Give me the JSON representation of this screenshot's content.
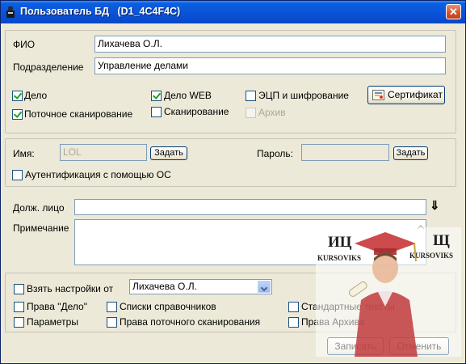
{
  "window": {
    "title": "Пользователь БД   (D1_4C4F4C)",
    "close_glyph": "✕"
  },
  "user": {
    "fio_label": "ФИО",
    "fio_value": "Лихачева О.Л.",
    "department_label": "Подразделение",
    "department_value": "Управление делами"
  },
  "modules": {
    "delo": {
      "label": "Дело",
      "checked": true
    },
    "delo_web": {
      "label": "Дело WEB",
      "checked": true
    },
    "ecp": {
      "label": "ЭЦП и шифрование",
      "checked": false
    },
    "stream_scan": {
      "label": "Поточное сканирование",
      "checked": true
    },
    "scan": {
      "label": "Сканирование",
      "checked": false
    },
    "archive": {
      "label": "Архив",
      "checked": false,
      "disabled": true
    },
    "certificate_button": "Сертификат"
  },
  "auth": {
    "name_label": "Имя:",
    "name_value": "LOL",
    "name_set_button": "Задать",
    "password_label": "Пароль:",
    "password_value": "",
    "password_set_button": "Задать",
    "os_auth_label": "Аутентификация с помощью ОС",
    "os_auth_checked": false
  },
  "details": {
    "official_label": "Долж. лицо",
    "official_value": "",
    "official_button_glyph": "⇓",
    "note_label": "Примечание",
    "note_value": ""
  },
  "settings": {
    "take_from_label": "Взять настройки от",
    "take_from_value": "Лихачева О.Л.",
    "items": [
      {
        "label": "Права \"Дело\"",
        "checked": false
      },
      {
        "label": "Списки справочников",
        "checked": false
      },
      {
        "label": "Стандартные тексты",
        "checked": false
      },
      {
        "label": "Параметры",
        "checked": false
      },
      {
        "label": "Права поточного сканирования",
        "checked": false
      },
      {
        "label": "Права Архива",
        "checked": false
      }
    ]
  },
  "footer": {
    "save_button": "Записать",
    "cancel_button": "Отменить"
  },
  "watermark": {
    "left_mark": "ИЦ",
    "left_sub": "KURSOVIKS",
    "right_mark": "Щ",
    "right_sub": "KURSOVIKS"
  },
  "colors": {
    "titlebar": "#0a53d8",
    "window_bg": "#ece9d8",
    "check_green": "#21a121",
    "close_red": "#d0522b"
  }
}
